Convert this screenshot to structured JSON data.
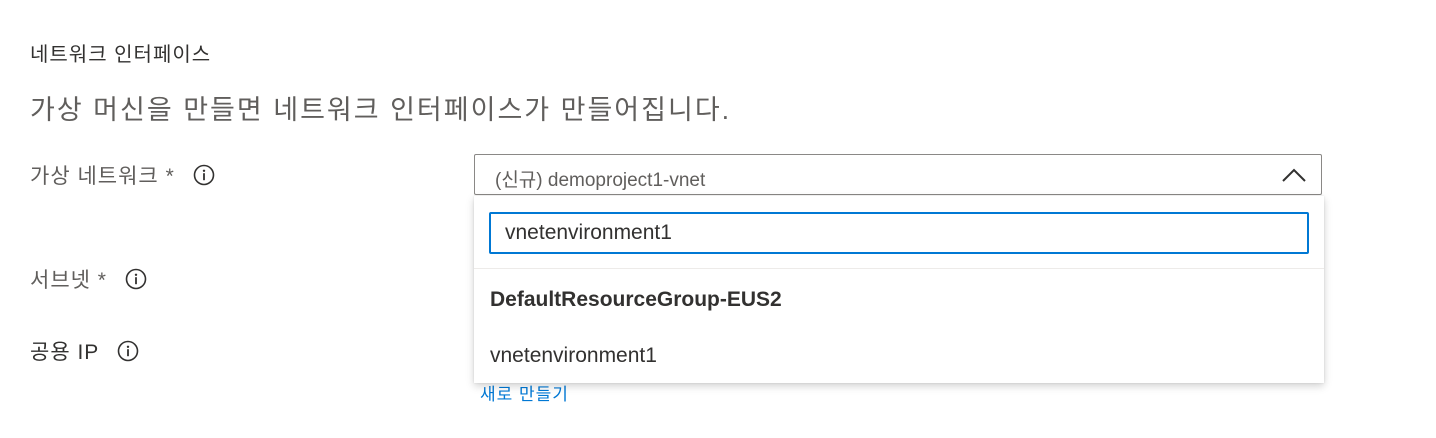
{
  "section": {
    "heading": "네트워크 인터페이스",
    "description": "가상 머신을 만들면 네트워크 인터페이스가 만들어집니다."
  },
  "fields": {
    "virtual_network_label": "가상 네트워크 *",
    "subnet_label": "서브넷 *",
    "public_ip_label": "공용 IP"
  },
  "dropdown": {
    "selected_value": "(신규) demoproject1-vnet",
    "filter_value": "vnetenvironment1",
    "group_header": "DefaultResourceGroup-EUS2",
    "options": [
      "vnetenvironment1"
    ]
  },
  "create_new_link": "새로 만들기",
  "icons": {
    "info": "info-icon",
    "chevron": "chevron-up-icon"
  },
  "colors": {
    "accent": "#0078d4",
    "text": "#323130",
    "muted": "#605e5c"
  }
}
